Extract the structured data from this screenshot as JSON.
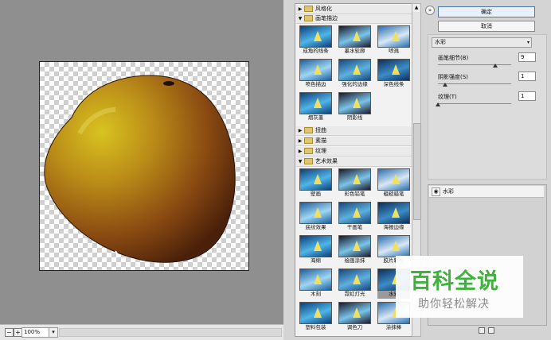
{
  "preview": {
    "zoom": "100%",
    "fit_btn_left": "−",
    "fit_btn_right": "+"
  },
  "gallery": {
    "categories": [
      {
        "label": "风格化",
        "expanded": false
      },
      {
        "label": "画笔描边",
        "expanded": true
      },
      {
        "label": "扭曲",
        "expanded": false
      },
      {
        "label": "素描",
        "expanded": false
      },
      {
        "label": "纹理",
        "expanded": false
      },
      {
        "label": "艺术效果",
        "expanded": true
      }
    ],
    "brush_filters": [
      "成角的线条",
      "墨水轮廓",
      "喷溅",
      "喷色描边",
      "强化的边缘",
      "深色线条",
      "烟灰墨",
      "阴影线"
    ],
    "art_filters": [
      "壁画",
      "彩色铅笔",
      "粗糙蜡笔",
      "底纹效果",
      "干画笔",
      "海报边缘",
      "海绵",
      "绘画涂抹",
      "胶片颗粒",
      "木刻",
      "霓虹灯光",
      "水彩",
      "塑料包装",
      "调色刀",
      "涂抹棒"
    ],
    "selected": "水彩"
  },
  "buttons": {
    "ok": "确定",
    "cancel": "取消",
    "collapse": "»"
  },
  "settings": {
    "filter": "水彩",
    "params": [
      {
        "label": "画笔细节(B)",
        "value": "9",
        "fraction": 0.78
      },
      {
        "label": "阴影强度(S)",
        "value": "1",
        "fraction": 0.1
      },
      {
        "label": "纹理(T)",
        "value": "1",
        "fraction": 0.0
      }
    ]
  },
  "layers": {
    "name": "水彩",
    "eye": "◉"
  },
  "watermark": {
    "title": "百科全说",
    "subtitle": "助你轻松解决"
  },
  "colors": {
    "accent": "#3db33c",
    "selection": "#9a9a9a",
    "apple_light": "#c8a81c",
    "apple_dark": "#5a2a0a"
  }
}
